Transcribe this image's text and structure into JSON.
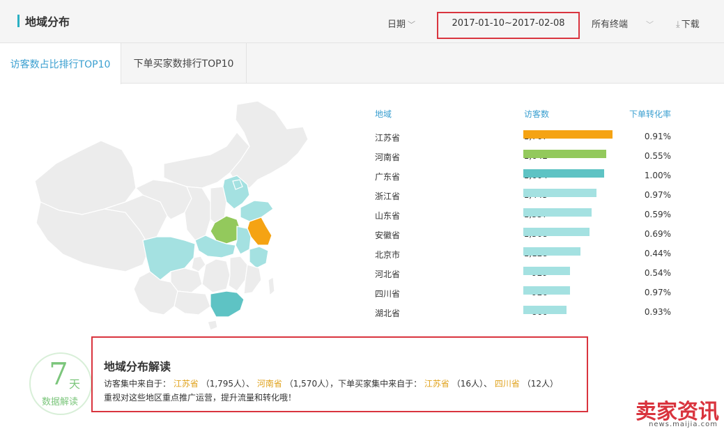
{
  "header": {
    "title": "地域分布",
    "date_label": "日期",
    "date_range": "2017-01-10~2017-02-08",
    "terminal_label": "所有终端",
    "download_label": "下载"
  },
  "tabs": [
    {
      "label": "访客数占比排行TOP10",
      "active": true
    },
    {
      "label": "下单买家数排行TOP10",
      "active": false
    }
  ],
  "table": {
    "columns": [
      "地域",
      "访客数",
      "下单转化率"
    ],
    "rows": [
      {
        "region": "江苏省",
        "visits": "1,767",
        "value": 1767,
        "rate": "0.91%",
        "color": "#f5a313"
      },
      {
        "region": "河南省",
        "visits": "1,642",
        "value": 1642,
        "rate": "0.55%",
        "color": "#93c95c"
      },
      {
        "region": "广东省",
        "visits": "1,604",
        "value": 1604,
        "rate": "1.00%",
        "color": "#5ec3c4"
      },
      {
        "region": "浙江省",
        "visits": "1,445",
        "value": 1445,
        "rate": "0.97%",
        "color": "#a4e1e1"
      },
      {
        "region": "山东省",
        "visits": "1,357",
        "value": 1357,
        "rate": "0.59%",
        "color": "#a4e1e1"
      },
      {
        "region": "安徽省",
        "visits": "1,308",
        "value": 1308,
        "rate": "0.69%",
        "color": "#a4e1e1"
      },
      {
        "region": "北京市",
        "visits": "1,128",
        "value": 1128,
        "rate": "0.44%",
        "color": "#a4e1e1"
      },
      {
        "region": "河北省",
        "visits": "929",
        "value": 929,
        "rate": "0.54%",
        "color": "#a4e1e1"
      },
      {
        "region": "四川省",
        "visits": "926",
        "value": 926,
        "rate": "0.97%",
        "color": "#a4e1e1"
      },
      {
        "region": "湖北省",
        "visits": "860",
        "value": 860,
        "rate": "0.93%",
        "color": "#a4e1e1"
      }
    ]
  },
  "badge": {
    "number": "7",
    "unit": "天",
    "label": "数据解读"
  },
  "insight": {
    "title": "地域分布解读",
    "line1_prefix": "访客集中来自于：",
    "region1": "江苏省",
    "count1": "（1,795人）、",
    "region2": "河南省",
    "count2": "（1,570人），下单买家集中来自于：",
    "region3": "江苏省",
    "count3": "（16人）、",
    "region4": "四川省",
    "count4": "（12人）",
    "line2": "重视对这些地区重点推广运营，提升流量和转化哦！"
  },
  "watermark": {
    "main": "卖家资讯",
    "sub": "news.maijia.com"
  },
  "colors": {
    "accent": "#2bb0c3",
    "tab_active": "#3a9fd0",
    "highlight_box": "#d9343e",
    "bar_top": "#f5a313"
  }
}
